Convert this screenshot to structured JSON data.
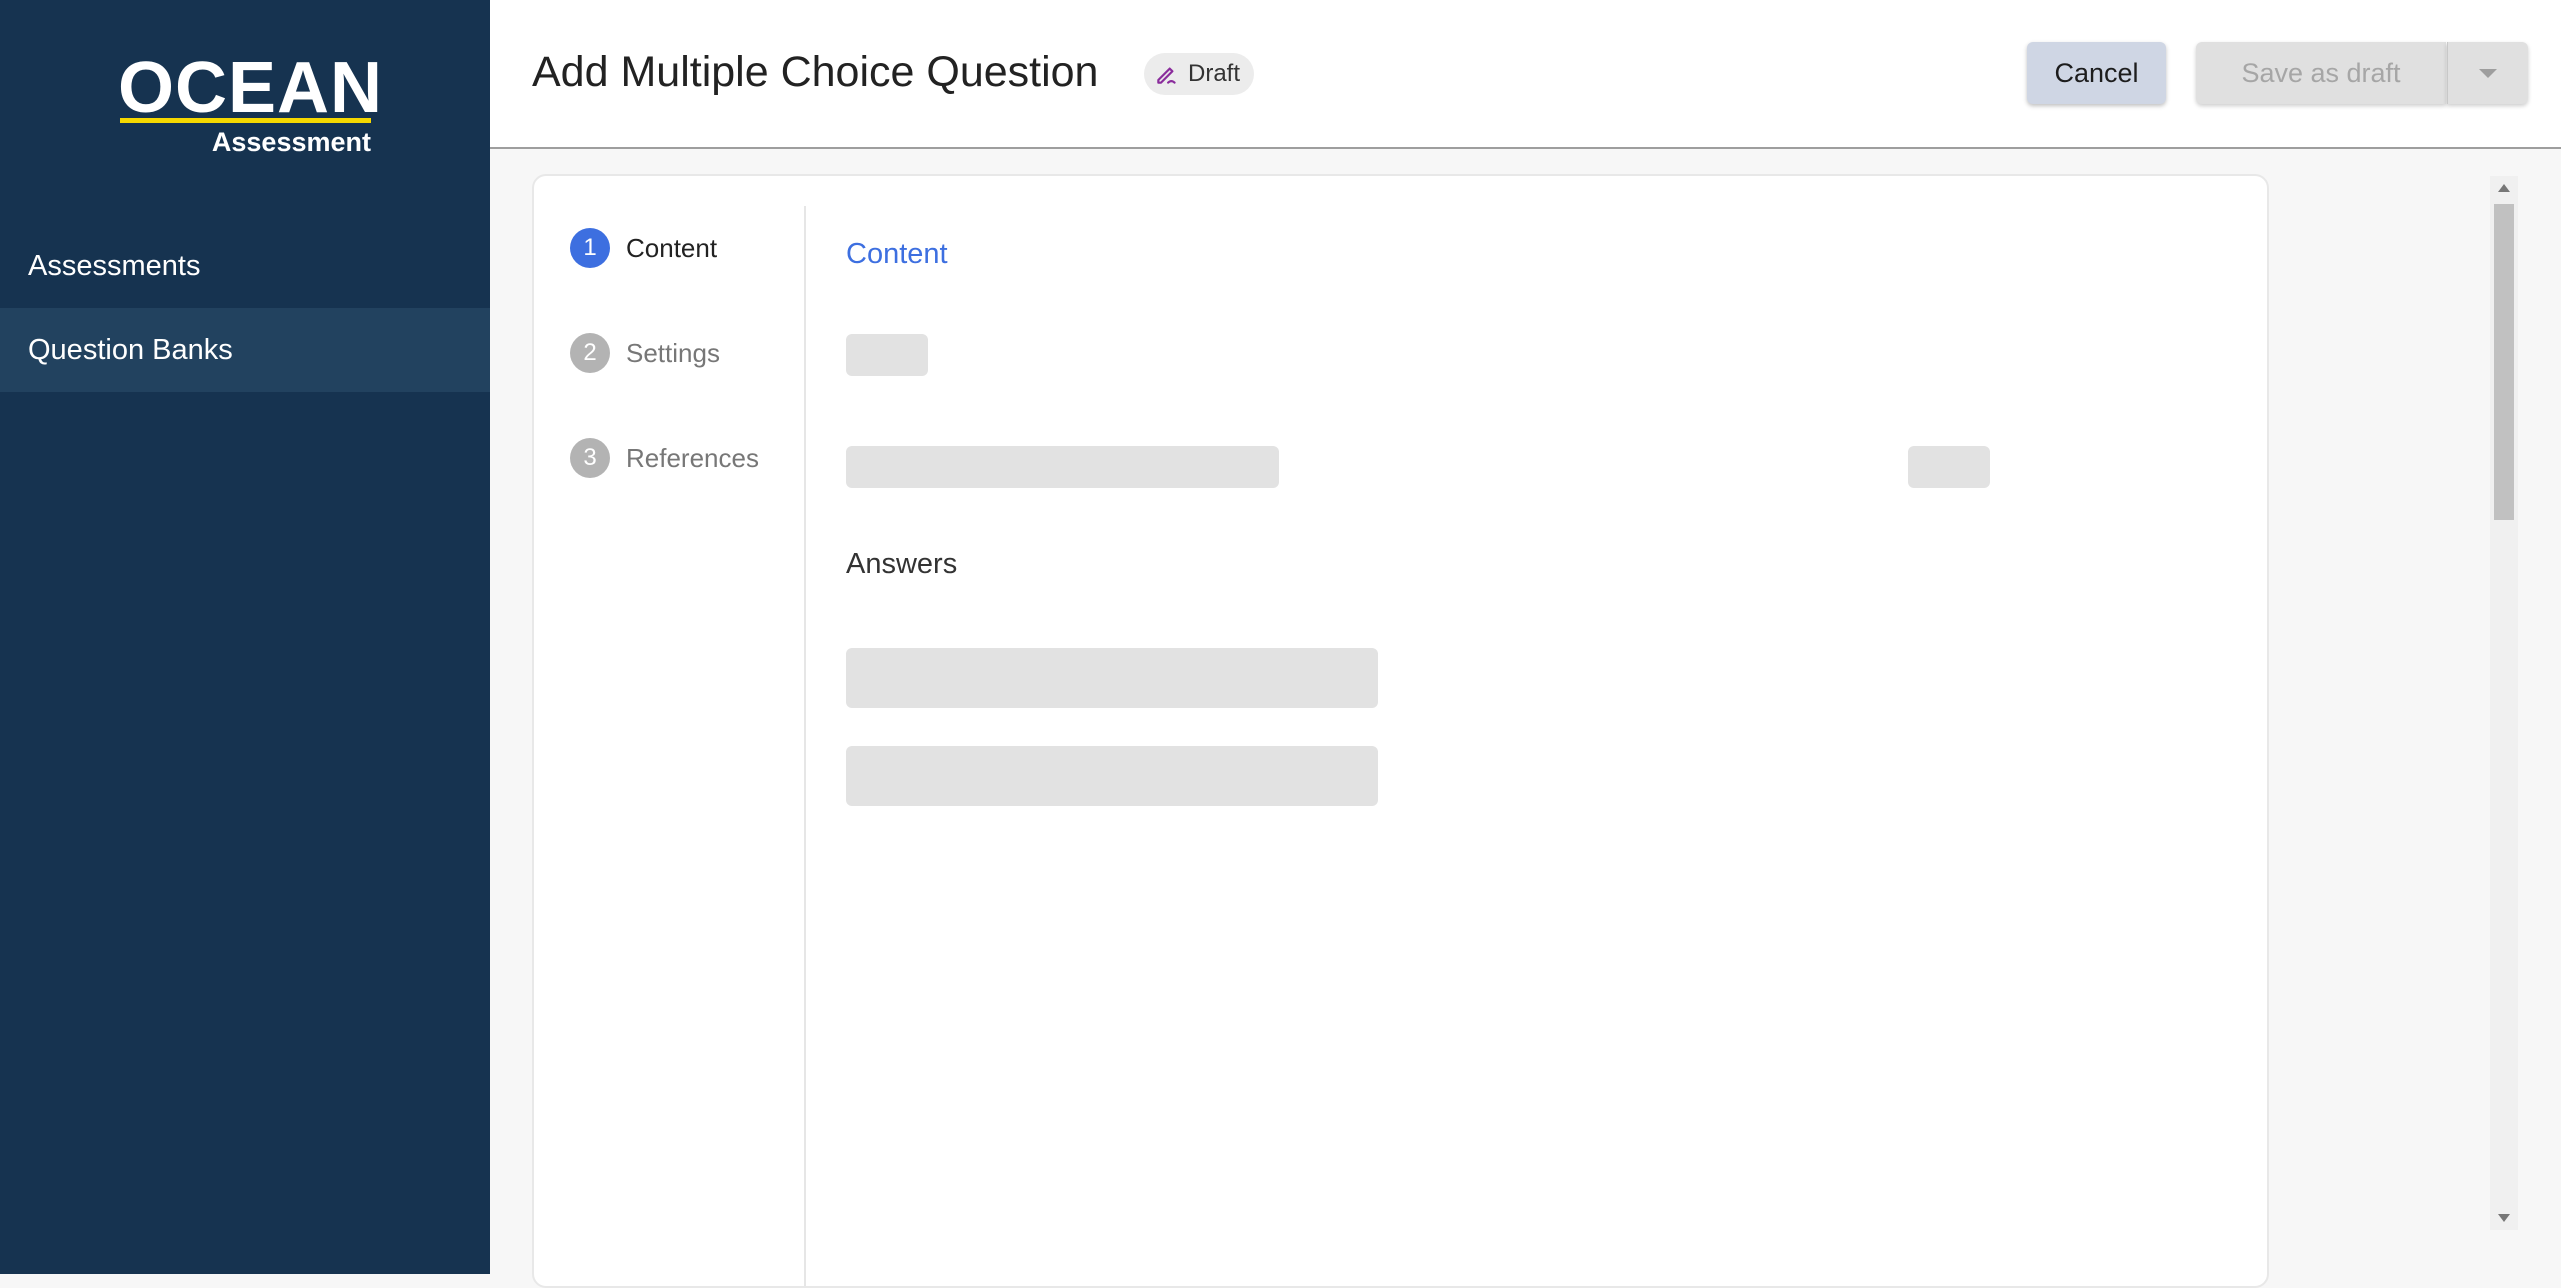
{
  "sidebar": {
    "logo": {
      "main": "OCEAN",
      "sub": "Assessment"
    },
    "items": [
      {
        "label": "Assessments",
        "active": false
      },
      {
        "label": "Question Banks",
        "active": true
      }
    ]
  },
  "header": {
    "title": "Add Multiple Choice Question",
    "status_badge": "Draft",
    "cancel_label": "Cancel",
    "save_label": "Save as draft"
  },
  "stepper": {
    "steps": [
      {
        "number": "1",
        "label": "Content",
        "active": true
      },
      {
        "number": "2",
        "label": "Settings",
        "active": false
      },
      {
        "number": "3",
        "label": "References",
        "active": false
      }
    ]
  },
  "content": {
    "section_title": "Content",
    "answers_title": "Answers"
  },
  "colors": {
    "sidebar_bg": "#163350",
    "sidebar_active": "#22425f",
    "logo_accent": "#f5d800",
    "accent_blue": "#3d6fe0",
    "cancel_bg": "#cfd6e4",
    "draft_icon": "#8a2c9c"
  }
}
